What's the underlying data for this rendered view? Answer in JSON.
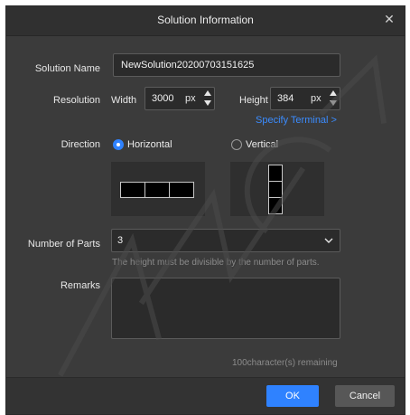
{
  "dialog": {
    "title": "Solution Information",
    "close_icon": "close-icon"
  },
  "form": {
    "solution_name_label": "Solution Name",
    "solution_name_value": "NewSolution20200703151625",
    "resolution_label": "Resolution",
    "width_label": "Width",
    "width_value": "3000",
    "width_unit": "px",
    "height_label": "Height",
    "height_value": "384",
    "height_unit": "px",
    "specify_terminal": "Specify Terminal >",
    "direction_label": "Direction",
    "direction_horizontal": "Horizontal",
    "direction_vertical": "Vertical",
    "direction_selected": "Horizontal",
    "parts_label": "Number of Parts",
    "parts_value": "3",
    "parts_hint": "The height must be divisible by the number of parts.",
    "remarks_label": "Remarks",
    "remarks_value": "",
    "remarks_counter": "100character(s) remaining"
  },
  "footer": {
    "ok_label": "OK",
    "cancel_label": "Cancel"
  },
  "colors": {
    "accent": "#2f82ff",
    "dialog_bg": "#3b3b3b",
    "link": "#3b8cff"
  }
}
